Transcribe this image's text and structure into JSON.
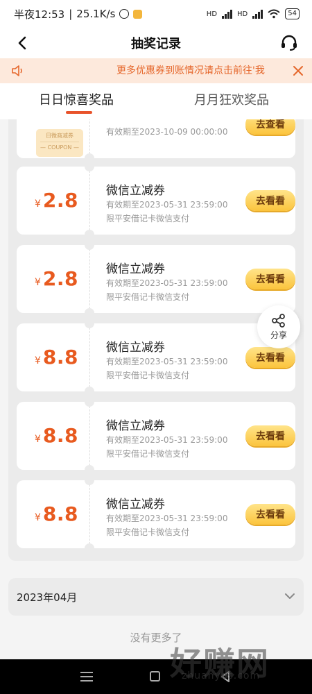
{
  "status_bar": {
    "time": "半夜12:53",
    "speed": "25.1K/s",
    "battery": "54",
    "net1": "HD",
    "net2": "HD"
  },
  "nav": {
    "title": "抽奖记录"
  },
  "notice": {
    "text": "更多优惠券到账情况请点击前往'我"
  },
  "tabs": [
    {
      "label": "日日惊喜奖品",
      "active": true
    },
    {
      "label": "月月狂欢奖品",
      "active": false
    }
  ],
  "first_card": {
    "thumb_title": "日微商减券",
    "thumb_sub": "— COUPON —",
    "expiry": "有效期至2023-10-09 00:00:00",
    "button": "去查看"
  },
  "coupons": [
    {
      "currency": "¥",
      "amount": "2.8",
      "title": "微信立减券",
      "expiry": "有效期至2023-05-31 23:59:00",
      "limit": "限平安借记卡微信支付",
      "button": "去看看"
    },
    {
      "currency": "¥",
      "amount": "2.8",
      "title": "微信立减券",
      "expiry": "有效期至2023-05-31 23:59:00",
      "limit": "限平安借记卡微信支付",
      "button": "去看看"
    },
    {
      "currency": "¥",
      "amount": "8.8",
      "title": "微信立减券",
      "expiry": "有效期至2023-05-31 23:59:00",
      "limit": "限平安借记卡微信支付",
      "button": "去看看"
    },
    {
      "currency": "¥",
      "amount": "8.8",
      "title": "微信立减券",
      "expiry": "有效期至2023-05-31 23:59:00",
      "limit": "限平安借记卡微信支付",
      "button": "去看看"
    },
    {
      "currency": "¥",
      "amount": "8.8",
      "title": "微信立减券",
      "expiry": "有效期至2023-05-31 23:59:00",
      "limit": "限平安借记卡微信支付",
      "button": "去看看"
    }
  ],
  "share": {
    "label": "分享"
  },
  "month_section": {
    "label": "2023年04月"
  },
  "footer": {
    "no_more": "没有更多了"
  },
  "watermark": {
    "main": "好赚网",
    "sub": "zhuanyes.com"
  },
  "colors": {
    "accent": "#e85a1f",
    "tab_underline": "#e8532b",
    "notice_bg": "#fde9dc",
    "button_yellow": "#fbc43d"
  }
}
